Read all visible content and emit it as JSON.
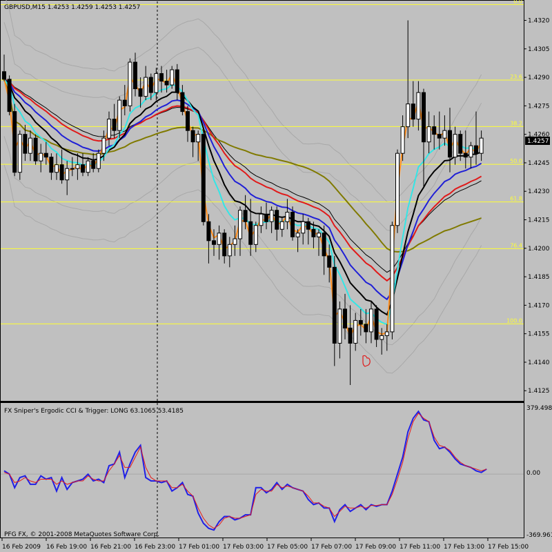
{
  "colors": {
    "background": "#c0c0c0",
    "fib": "#ffff33",
    "cyan_ma": "#33e6e6",
    "orange_ma": "#ff8c1a",
    "blue_ma": "#1f1fd6",
    "red_ma": "#e01a1a",
    "olive_ma": "#807a00",
    "black_ma": "#000000",
    "envelope": "#a8a8a8",
    "cci": "#1f1fe6",
    "trigger": "#e61a1a"
  },
  "header": {
    "symbol_info": "GBPUSD,M15  1.4253 1.4259 1.4253 1.4257"
  },
  "indicator": {
    "title": "FX Sniper's Ergodic CCI & Trigger: LONG 63.1065 53.4185",
    "axis_labels": [
      "379.4988",
      "0.00",
      "-369.961"
    ]
  },
  "footer": {
    "copyright": "PFG FX, © 2001-2008 MetaQuotes Software Corp."
  },
  "chart_data": [
    {
      "type": "candlestick",
      "title": "GBPUSD,M15",
      "x_labels": [
        "16 Feb 2009",
        "16 Feb 19:00",
        "16 Feb 21:00",
        "16 Feb 23:00",
        "17 Feb 01:00",
        "17 Feb 03:00",
        "17 Feb 05:00",
        "17 Feb 07:00",
        "17 Feb 09:00",
        "17 Feb 11:00",
        "17 Feb 13:00",
        "17 Feb 15:00"
      ],
      "y_ticks": [
        "1.4320",
        "1.4305",
        "1.4290",
        "1.4275",
        "1.4260",
        "1.4245",
        "1.4230",
        "1.4215",
        "1.4200",
        "1.4185",
        "1.4170",
        "1.4155",
        "1.4140",
        "1.4125"
      ],
      "ylim": [
        1.412,
        1.433
      ],
      "current_price": "1.4257",
      "fibonacci_levels": [
        {
          "label": "0.0",
          "price": 1.43283
        },
        {
          "label": "23.6",
          "price": 1.42886
        },
        {
          "label": "38.2",
          "price": 1.42641
        },
        {
          "label": "50.0",
          "price": 1.42442
        },
        {
          "label": "61.8",
          "price": 1.42244
        },
        {
          "label": "76.4",
          "price": 1.41998
        },
        {
          "label": "100.0",
          "price": 1.41602
        }
      ],
      "candles": [
        [
          1.4293,
          1.4302,
          1.4288,
          1.4289
        ],
        [
          1.4289,
          1.4291,
          1.427,
          1.4272
        ],
        [
          1.4272,
          1.4276,
          1.4238,
          1.424
        ],
        [
          1.424,
          1.4262,
          1.4236,
          1.426
        ],
        [
          1.426,
          1.4265,
          1.4246,
          1.425
        ],
        [
          1.425,
          1.4262,
          1.4246,
          1.4258
        ],
        [
          1.4258,
          1.426,
          1.4244,
          1.4246
        ],
        [
          1.4246,
          1.4255,
          1.424,
          1.425
        ],
        [
          1.425,
          1.4256,
          1.4244,
          1.4248
        ],
        [
          1.4248,
          1.425,
          1.4236,
          1.424
        ],
        [
          1.424,
          1.425,
          1.4236,
          1.4244
        ],
        [
          1.4244,
          1.4252,
          1.4234,
          1.4236
        ],
        [
          1.4236,
          1.4246,
          1.4228,
          1.4242
        ],
        [
          1.4242,
          1.4248,
          1.4238,
          1.4242
        ],
        [
          1.4242,
          1.425,
          1.4236,
          1.4244
        ],
        [
          1.4244,
          1.425,
          1.4238,
          1.424
        ],
        [
          1.424,
          1.4248,
          1.4238,
          1.4246
        ],
        [
          1.4246,
          1.425,
          1.424,
          1.4242
        ],
        [
          1.4242,
          1.4252,
          1.424,
          1.425
        ],
        [
          1.425,
          1.4262,
          1.4246,
          1.4258
        ],
        [
          1.4258,
          1.4272,
          1.4254,
          1.4268
        ],
        [
          1.4268,
          1.4276,
          1.4258,
          1.4262
        ],
        [
          1.4262,
          1.428,
          1.4258,
          1.4278
        ],
        [
          1.4278,
          1.4286,
          1.427,
          1.4275
        ],
        [
          1.4275,
          1.43,
          1.4272,
          1.4298
        ],
        [
          1.4298,
          1.4303,
          1.428,
          1.4284
        ],
        [
          1.4284,
          1.429,
          1.4274,
          1.428
        ],
        [
          1.428,
          1.4296,
          1.4278,
          1.429
        ],
        [
          1.429,
          1.4292,
          1.4278,
          1.4282
        ],
        [
          1.4282,
          1.4295,
          1.4278,
          1.4292
        ],
        [
          1.4292,
          1.4296,
          1.4282,
          1.4288
        ],
        [
          1.4288,
          1.4294,
          1.4282,
          1.4286
        ],
        [
          1.4286,
          1.4296,
          1.4284,
          1.4294
        ],
        [
          1.4294,
          1.4297,
          1.4278,
          1.4282
        ],
        [
          1.4282,
          1.4286,
          1.427,
          1.4272
        ],
        [
          1.4272,
          1.4275,
          1.4256,
          1.4262
        ],
        [
          1.4262,
          1.4264,
          1.4248,
          1.4256
        ],
        [
          1.4256,
          1.4262,
          1.4246,
          1.426
        ],
        [
          1.426,
          1.4262,
          1.4212,
          1.4214
        ],
        [
          1.4214,
          1.4218,
          1.4192,
          1.4204
        ],
        [
          1.4204,
          1.421,
          1.4196,
          1.4202
        ],
        [
          1.4202,
          1.4212,
          1.4194,
          1.4208
        ],
        [
          1.4208,
          1.421,
          1.4192,
          1.4196
        ],
        [
          1.4196,
          1.4206,
          1.419,
          1.4202
        ],
        [
          1.4202,
          1.4212,
          1.4196,
          1.4205
        ],
        [
          1.4205,
          1.4222,
          1.4196,
          1.422
        ],
        [
          1.422,
          1.4228,
          1.421,
          1.4214
        ],
        [
          1.4214,
          1.4226,
          1.4196,
          1.4202
        ],
        [
          1.4202,
          1.4214,
          1.4198,
          1.4212
        ],
        [
          1.4212,
          1.4222,
          1.4208,
          1.4218
        ],
        [
          1.4218,
          1.4224,
          1.421,
          1.4214
        ],
        [
          1.4214,
          1.4222,
          1.4208,
          1.422
        ],
        [
          1.422,
          1.4222,
          1.4204,
          1.421
        ],
        [
          1.421,
          1.4216,
          1.4206,
          1.4214
        ],
        [
          1.4214,
          1.4226,
          1.421,
          1.4219
        ],
        [
          1.4219,
          1.4222,
          1.4204,
          1.4206
        ],
        [
          1.4206,
          1.421,
          1.4198,
          1.4208
        ],
        [
          1.4208,
          1.4218,
          1.4202,
          1.4214
        ],
        [
          1.4214,
          1.4216,
          1.4202,
          1.421
        ],
        [
          1.421,
          1.4214,
          1.42,
          1.4206
        ],
        [
          1.4206,
          1.421,
          1.4196,
          1.4208
        ],
        [
          1.4208,
          1.4212,
          1.4186,
          1.4196
        ],
        [
          1.4196,
          1.4202,
          1.4182,
          1.419
        ],
        [
          1.419,
          1.4196,
          1.4138,
          1.415
        ],
        [
          1.415,
          1.4172,
          1.4142,
          1.4168
        ],
        [
          1.4168,
          1.4176,
          1.4152,
          1.4158
        ],
        [
          1.4158,
          1.417,
          1.4128,
          1.415
        ],
        [
          1.415,
          1.4166,
          1.4146,
          1.4162
        ],
        [
          1.4162,
          1.4168,
          1.4154,
          1.416
        ],
        [
          1.416,
          1.4168,
          1.415,
          1.4156
        ],
        [
          1.4156,
          1.4172,
          1.415,
          1.4168
        ],
        [
          1.4168,
          1.417,
          1.4148,
          1.4152
        ],
        [
          1.4152,
          1.4158,
          1.4144,
          1.4154
        ],
        [
          1.4154,
          1.416,
          1.4146,
          1.4156
        ],
        [
          1.4156,
          1.4214,
          1.4152,
          1.4212
        ],
        [
          1.4212,
          1.4252,
          1.4208,
          1.425
        ],
        [
          1.425,
          1.427,
          1.4246,
          1.4264
        ],
        [
          1.4264,
          1.432,
          1.4258,
          1.4276
        ],
        [
          1.4276,
          1.4288,
          1.4264,
          1.4268
        ],
        [
          1.4268,
          1.4288,
          1.4262,
          1.4282
        ],
        [
          1.4282,
          1.4284,
          1.4232,
          1.4256
        ],
        [
          1.4256,
          1.4272,
          1.425,
          1.4264
        ],
        [
          1.4264,
          1.427,
          1.4252,
          1.426
        ],
        [
          1.426,
          1.4272,
          1.4252,
          1.4258
        ],
        [
          1.4258,
          1.427,
          1.4254,
          1.4262
        ],
        [
          1.4262,
          1.4274,
          1.424,
          1.4248
        ],
        [
          1.4248,
          1.4264,
          1.4244,
          1.426
        ],
        [
          1.426,
          1.4262,
          1.4246,
          1.425
        ],
        [
          1.425,
          1.4262,
          1.4242,
          1.4248
        ],
        [
          1.4248,
          1.4256,
          1.4242,
          1.4254
        ],
        [
          1.4254,
          1.4272,
          1.4244,
          1.425
        ],
        [
          1.425,
          1.4262,
          1.4246,
          1.4258
        ]
      ]
    },
    {
      "type": "line",
      "title": "FX Sniper's Ergodic CCI & Trigger",
      "ylim": [
        -369.961,
        379.4988
      ],
      "series": [
        {
          "name": "Ergodic CCI",
          "values": [
            20,
            0,
            -80,
            -20,
            -10,
            -60,
            -60,
            -10,
            -30,
            -20,
            -100,
            -20,
            -90,
            -50,
            -40,
            -30,
            0,
            -40,
            -30,
            -50,
            50,
            60,
            130,
            -20,
            60,
            130,
            170,
            -20,
            -40,
            -40,
            -50,
            -40,
            -100,
            -80,
            -50,
            -120,
            -130,
            -230,
            -290,
            -320,
            -330,
            -280,
            -250,
            -250,
            -270,
            -260,
            -240,
            -240,
            -80,
            -80,
            -110,
            -90,
            -50,
            -90,
            -60,
            -80,
            -90,
            -100,
            -150,
            -180,
            -170,
            -200,
            -200,
            -280,
            -210,
            -180,
            -220,
            -200,
            -180,
            -210,
            -180,
            -190,
            -180,
            -180,
            -100,
            0,
            100,
            250,
            330,
            370,
            320,
            310,
            200,
            150,
            160,
            130,
            90,
            60,
            50,
            40,
            20,
            10,
            30
          ]
        },
        {
          "name": "Trigger",
          "values": [
            10,
            0,
            -50,
            -40,
            -20,
            -40,
            -50,
            -30,
            -30,
            -30,
            -60,
            -40,
            -60,
            -50,
            -40,
            -40,
            -10,
            -30,
            -40,
            -40,
            20,
            60,
            110,
            40,
            40,
            100,
            160,
            40,
            -20,
            -40,
            -40,
            -40,
            -80,
            -80,
            -60,
            -100,
            -130,
            -200,
            -260,
            -300,
            -320,
            -300,
            -260,
            -250,
            -260,
            -260,
            -250,
            -240,
            -120,
            -90,
            -100,
            -100,
            -60,
            -80,
            -70,
            -80,
            -90,
            -100,
            -130,
            -170,
            -170,
            -190,
            -200,
            -250,
            -220,
            -190,
            -200,
            -200,
            -190,
            -200,
            -185,
            -185,
            -180,
            -180,
            -120,
            -30,
            70,
            210,
            310,
            360,
            330,
            310,
            220,
            170,
            160,
            140,
            100,
            70,
            50,
            40,
            30,
            20,
            30
          ]
        }
      ]
    }
  ]
}
